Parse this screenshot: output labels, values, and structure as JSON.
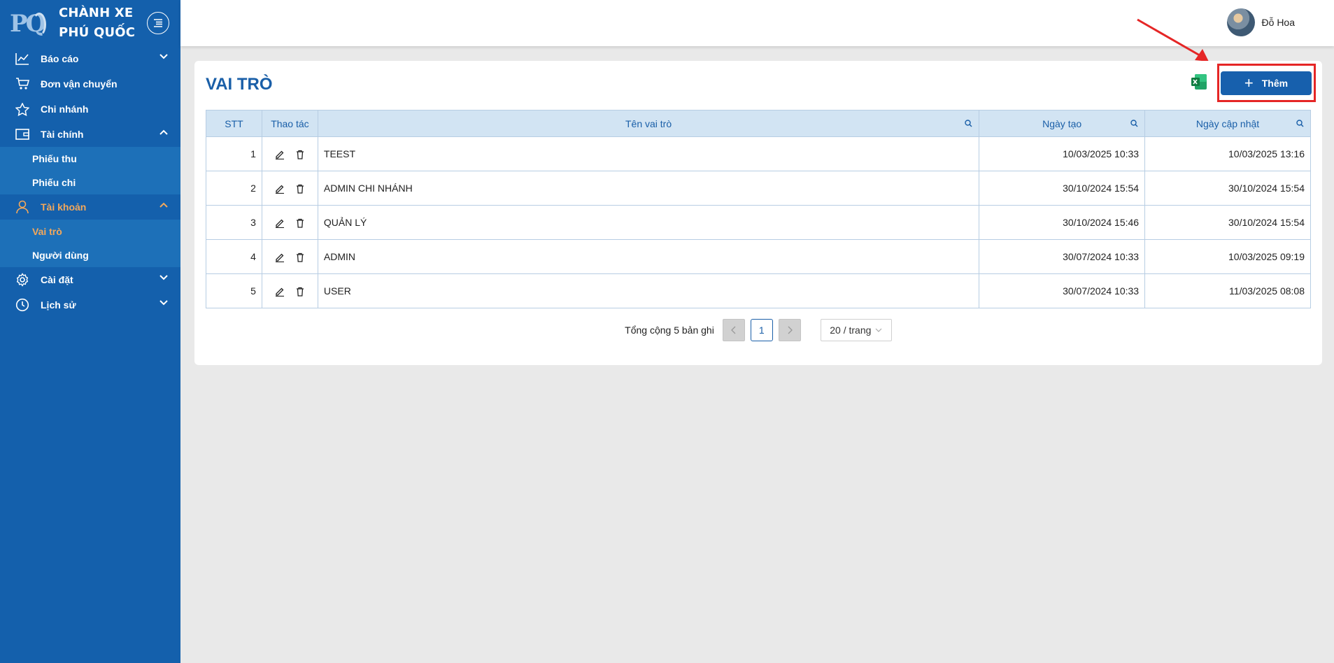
{
  "brand": {
    "name_line1": "CHÀNH XE",
    "name_line2": "PHÚ QUỐC",
    "logo_text": "PQ"
  },
  "sidebar": {
    "items": [
      {
        "label": "Báo cáo",
        "icon": "chart-line-icon",
        "chevron": "down"
      },
      {
        "label": "Đơn vận chuyển",
        "icon": "cart-icon"
      },
      {
        "label": "Chi nhánh",
        "icon": "star-icon"
      },
      {
        "label": "Tài chính",
        "icon": "wallet-icon",
        "chevron": "up"
      },
      {
        "label": "Tài khoản",
        "icon": "user-icon",
        "chevron": "up",
        "active": true
      },
      {
        "label": "Cài đặt",
        "icon": "gear-icon",
        "chevron": "down"
      },
      {
        "label": "Lịch sử",
        "icon": "clock-icon",
        "chevron": "down"
      }
    ],
    "finance_sub": [
      "Phiếu thu",
      "Phiếu chi"
    ],
    "account_sub": [
      "Vai trò",
      "Người dùng"
    ]
  },
  "header": {
    "user_name": "Đỗ Hoa"
  },
  "page": {
    "title": "VAI TRÒ",
    "add_label": "Thêm"
  },
  "table": {
    "columns": [
      "STT",
      "Thao tác",
      "Tên vai trò",
      "Ngày tạo",
      "Ngày cập nhật"
    ],
    "rows": [
      {
        "stt": "1",
        "name": "TEEST",
        "created": "10/03/2025 10:33",
        "updated": "10/03/2025 13:16"
      },
      {
        "stt": "2",
        "name": "ADMIN CHI NHÁNH",
        "created": "30/10/2024 15:54",
        "updated": "30/10/2024 15:54"
      },
      {
        "stt": "3",
        "name": "QUẢN LÝ",
        "created": "30/10/2024 15:46",
        "updated": "30/10/2024 15:54"
      },
      {
        "stt": "4",
        "name": "ADMIN",
        "created": "30/07/2024 10:33",
        "updated": "10/03/2025 09:19"
      },
      {
        "stt": "5",
        "name": "USER",
        "created": "30/07/2024 10:33",
        "updated": "11/03/2025 08:08"
      }
    ]
  },
  "pagination": {
    "total_text": "Tổng cộng 5 bản ghi",
    "current_page": "1",
    "page_size": "20 / trang"
  },
  "colors": {
    "sidebar": "#1460ac",
    "submenu": "#1d70b8",
    "accent": "#1760ad",
    "active_text": "#f3a85b",
    "highlight": "#e52626"
  }
}
